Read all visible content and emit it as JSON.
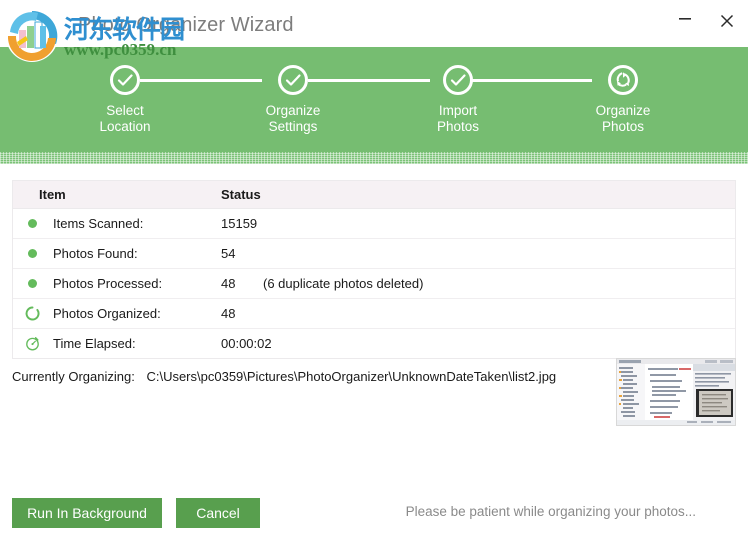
{
  "window": {
    "title": "Photo Organizer Wizard",
    "minimize_label": "─",
    "close_label": "✕"
  },
  "watermark": {
    "cn_text": "河东软件园",
    "url_text": "www.pc0359.cn"
  },
  "stepper": {
    "steps": [
      {
        "label": "Select\nLocation",
        "icon": "check-icon",
        "state": "done"
      },
      {
        "label": "Organize\nSettings",
        "icon": "check-icon",
        "state": "done"
      },
      {
        "label": "Import\nPhotos",
        "icon": "check-icon",
        "state": "done"
      },
      {
        "label": "Organize\nPhotos",
        "icon": "sync-arrows-icon",
        "state": "active"
      }
    ]
  },
  "table": {
    "headers": {
      "item": "Item",
      "status": "Status"
    },
    "rows": [
      {
        "icon": "green-dot-icon",
        "label": "Items Scanned:",
        "value": "15159",
        "note": ""
      },
      {
        "icon": "green-dot-icon",
        "label": "Photos Found:",
        "value": "54",
        "note": ""
      },
      {
        "icon": "green-dot-icon",
        "label": "Photos Processed:",
        "value": "48",
        "note": "(6 duplicate photos deleted)"
      },
      {
        "icon": "spinner-icon",
        "label": "Photos Organized:",
        "value": "48",
        "note": ""
      },
      {
        "icon": "stopwatch-icon",
        "label": "Time Elapsed:",
        "value": "00:00:02",
        "note": ""
      }
    ]
  },
  "current": {
    "label": "Currently Organizing:",
    "path": "C:\\Users\\pc0359\\Pictures\\PhotoOrganizer\\UnknownDateTaken\\list2.jpg"
  },
  "footer": {
    "run_background_label": "Run In Background",
    "cancel_label": "Cancel",
    "message": "Please be patient while organizing your photos..."
  },
  "colors": {
    "band_green": "#76bd71",
    "button_green": "#589f4e",
    "dot_green": "#64bb5c",
    "header_bg": "#f6f1f4",
    "title_gray": "#7d7d7d",
    "footer_msg_gray": "#8a8a8a"
  }
}
